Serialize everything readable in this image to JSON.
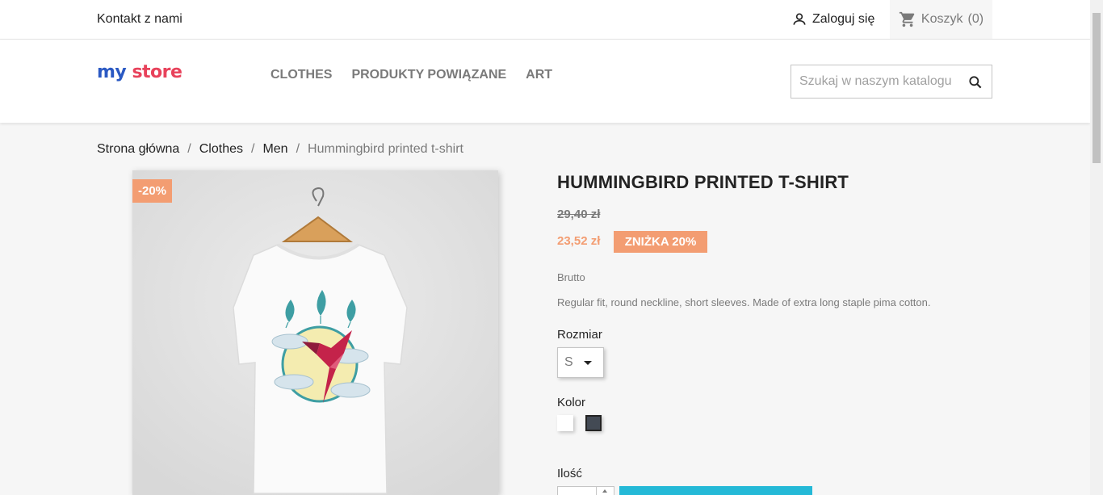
{
  "topbar": {
    "contact_label": "Kontakt z nami",
    "login_label": "Zaloguj się",
    "cart_label": "Koszyk",
    "cart_count": "(0)"
  },
  "header": {
    "logo": {
      "part1": "my",
      "part2": "store"
    },
    "nav": [
      {
        "label": "CLOTHES"
      },
      {
        "label": "PRODUKTY POWIĄZANE"
      },
      {
        "label": "ART"
      }
    ],
    "search": {
      "placeholder": "Szukaj w naszym katalogu",
      "value": ""
    }
  },
  "breadcrumb": [
    {
      "label": "Strona główna"
    },
    {
      "label": "Clothes"
    },
    {
      "label": "Men"
    },
    {
      "label": "Hummingbird printed t-shirt"
    }
  ],
  "breadcrumb_separator": "/",
  "product": {
    "flag": "-20%",
    "title": "Hummingbird printed t-shirt",
    "regular_price": "29,40 zł",
    "price": "23,52 zł",
    "discount": "ZNIŻKA 20%",
    "tax_label": "Brutto",
    "description": "Regular fit, round neckline, short sleeves. Made of extra long staple pima cotton.",
    "size_label": "Rozmiar",
    "size_value": "S",
    "color_label": "Kolor",
    "colors": [
      {
        "name": "white",
        "hex": "#ffffff"
      },
      {
        "name": "dark",
        "hex": "#434a54"
      }
    ],
    "quantity_label": "Ilość"
  },
  "colors": {
    "accent": "#24b9d7",
    "discount": "#f39d72",
    "text": "#232323",
    "muted": "#7a7a7a"
  }
}
